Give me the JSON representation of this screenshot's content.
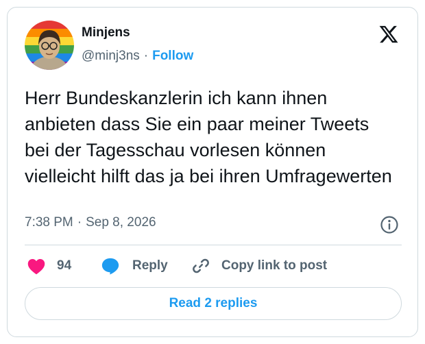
{
  "author": {
    "display_name": "Minjens",
    "handle": "@minj3ns",
    "separator": "·",
    "follow_label": "Follow"
  },
  "tweet": {
    "text": "Herr Bundeskanzlerin ich kann ihnen anbieten dass Sie ein paar meiner Tweets bei der Tagesschau vorlesen können vielleicht hilft das ja bei ihren Umfragewerten",
    "time": "7:38 PM",
    "separator": "·",
    "date": "Sep 8, 2026"
  },
  "actions": {
    "like_count": "94",
    "reply_label": "Reply",
    "copy_link_label": "Copy link to post"
  },
  "replies_button_label": "Read 2 replies",
  "icons": {
    "brand": "x-logo-icon",
    "info": "info-icon",
    "like": "heart-icon",
    "reply": "speech-bubble-icon",
    "copy": "link-icon"
  },
  "colors": {
    "accent": "#1d9bf0",
    "like": "#f91880",
    "text": "#0f1419",
    "muted": "#536471",
    "border": "#cfd9de"
  }
}
